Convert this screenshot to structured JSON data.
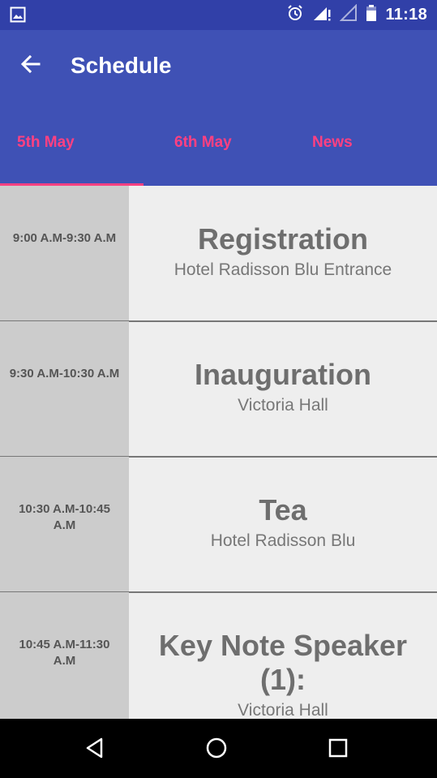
{
  "status_bar": {
    "time": "11:18",
    "icons": [
      "image-icon",
      "alarm-icon",
      "signal-icon",
      "signal-empty-icon",
      "battery-icon"
    ]
  },
  "app_bar": {
    "title": "Schedule",
    "back_icon": "arrow-left-icon"
  },
  "tabs": [
    {
      "label": "5th May",
      "selected": true
    },
    {
      "label": "6th May",
      "selected": false
    },
    {
      "label": "News",
      "selected": false
    }
  ],
  "schedule": [
    {
      "time": "9:00 A.M-9:30 A.M",
      "title": "Registration",
      "venue": "Hotel Radisson Blu Entrance"
    },
    {
      "time": "9:30 A.M-10:30 A.M",
      "title": "Inauguration",
      "venue": "Victoria Hall"
    },
    {
      "time": "10:30 A.M-10:45 A.M",
      "title": "Tea",
      "venue": "Hotel Radisson Blu"
    },
    {
      "time": "10:45 A.M-11:30 A.M",
      "title": "Key Note Speaker (1):",
      "venue": "Victoria Hall"
    }
  ],
  "nav_bar": {
    "icons": [
      "back-triangle-icon",
      "home-circle-icon",
      "recents-square-icon"
    ]
  },
  "colors": {
    "status_bar": "#3140a8",
    "app_bar": "#3f51b5",
    "accent": "#ff4081",
    "time_column": "#cccccc",
    "content_bg": "#eeeeee"
  }
}
